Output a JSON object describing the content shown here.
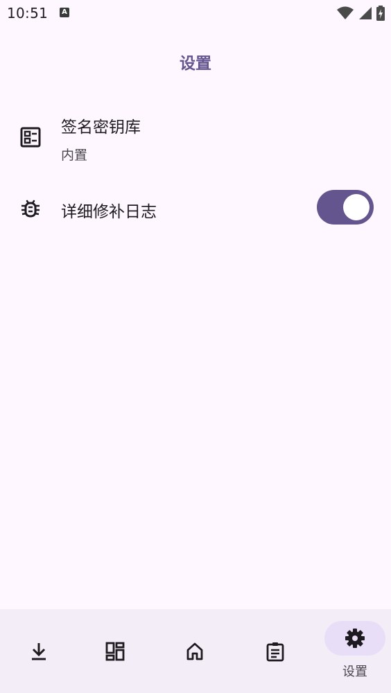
{
  "status_bar": {
    "time": "10:51",
    "app_icon_letter": "A"
  },
  "header": {
    "title": "设置"
  },
  "settings": {
    "keystore": {
      "title": "签名密钥库",
      "subtitle": "内置",
      "icon": "list-card-icon"
    },
    "verbose_log": {
      "title": "详细修补日志",
      "icon": "bug-icon",
      "enabled": true
    }
  },
  "bottom_nav": {
    "items": [
      {
        "icon": "download-icon",
        "label": ""
      },
      {
        "icon": "dashboard-icon",
        "label": ""
      },
      {
        "icon": "home-icon",
        "label": ""
      },
      {
        "icon": "clipboard-icon",
        "label": ""
      },
      {
        "icon": "gear-icon",
        "label": "设置",
        "selected": true
      }
    ]
  },
  "colors": {
    "background": "#fef7ff",
    "accent": "#65558f",
    "nav_background": "#f3edf7",
    "nav_selected_pill": "#e8def8"
  }
}
